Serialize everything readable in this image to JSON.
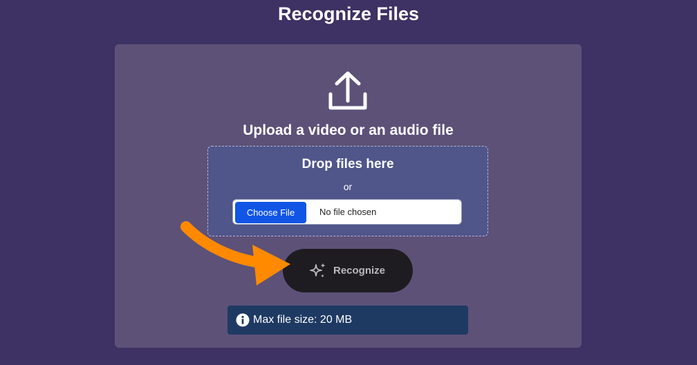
{
  "page": {
    "title": "Recognize Files"
  },
  "upload": {
    "icon": "upload-icon",
    "heading": "Upload a video or an audio file"
  },
  "dropzone": {
    "title": "Drop files here",
    "or_text": "or",
    "file_input": {
      "button_label": "Choose File",
      "status": "No file chosen"
    }
  },
  "recognize_button": {
    "icon": "sparkle-icon",
    "label": "Recognize"
  },
  "annotation": {
    "icon": "orange-arrow",
    "color": "#ff8a00"
  },
  "info": {
    "icon": "info-icon",
    "text": "Max file size: 20 MB"
  },
  "colors": {
    "background": "#3e3163",
    "card": "#5d5178",
    "dropzone": "#50558a",
    "choose_button": "#1155e6",
    "recognize_button": "#1e1c21",
    "info_box": "#1e3a63"
  }
}
